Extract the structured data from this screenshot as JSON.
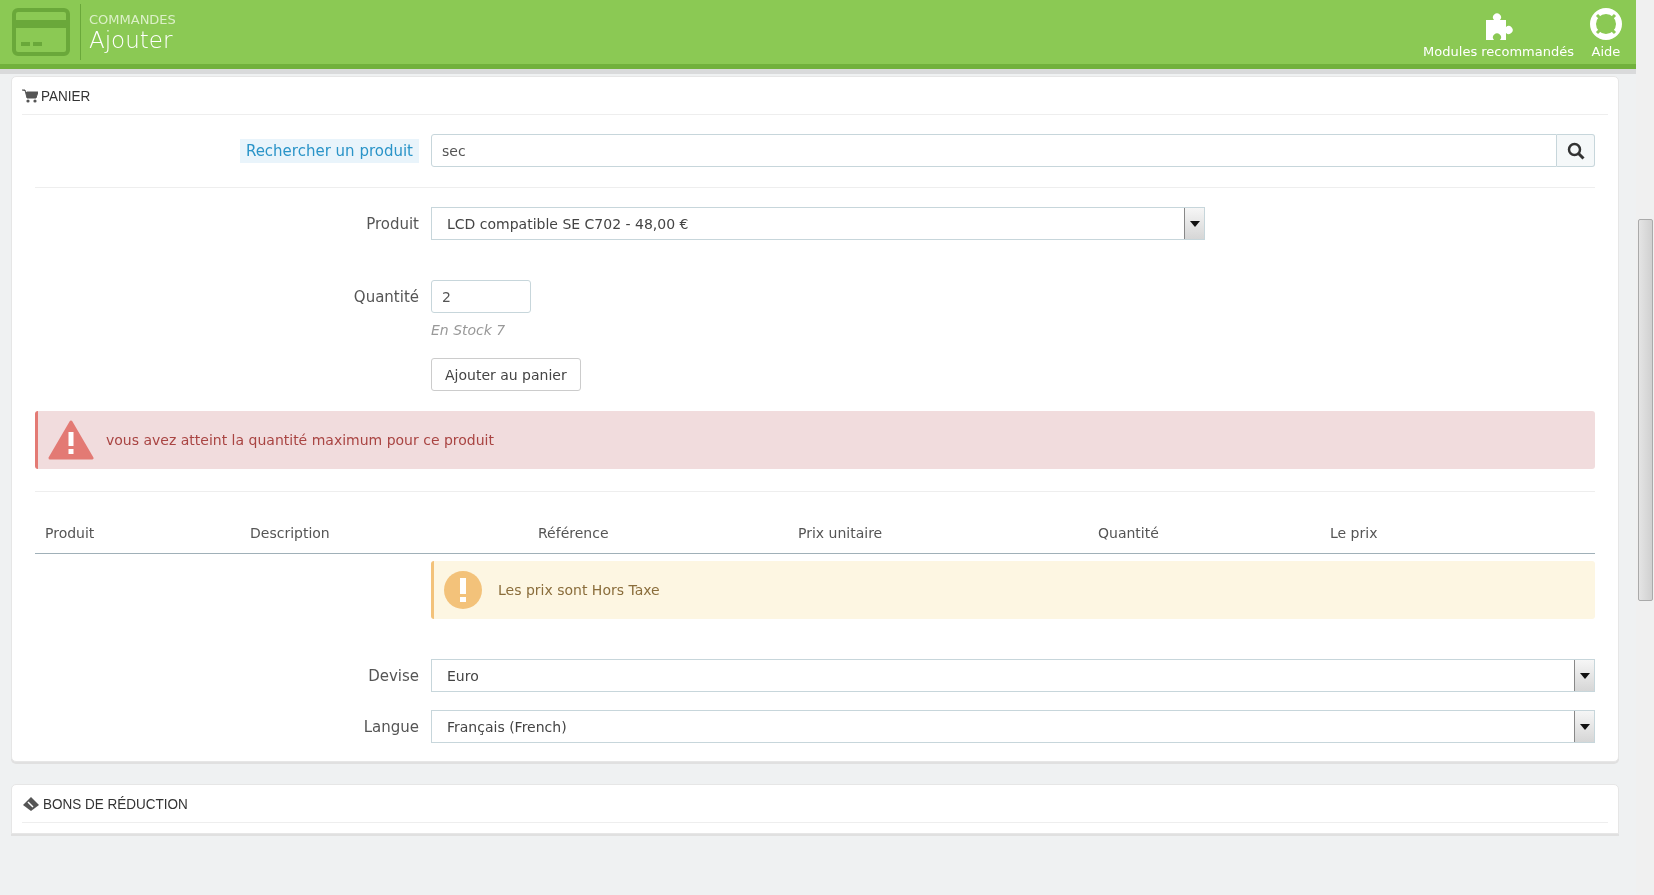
{
  "header": {
    "breadcrumb": "COMMANDES",
    "title": "Ajouter",
    "toolbar": [
      {
        "kind": "puzzle",
        "label": "Modules recommandés"
      },
      {
        "kind": "lifebuoy",
        "label": "Aide"
      }
    ]
  },
  "cart_panel": {
    "title": "PANIER",
    "search": {
      "label": "Rechercher un produit",
      "value": "sec"
    },
    "product": {
      "label": "Produit",
      "value": "LCD compatible SE C702 - 48,00 €"
    },
    "quantity": {
      "label": "Quantité",
      "value": "2",
      "stock_note": "En Stock 7"
    },
    "add_button": "Ajouter au panier",
    "error_alert": "vous avez atteint la quantité maximum pour ce produit",
    "table": {
      "columns": [
        "Produit",
        "Description",
        "Référence",
        "Prix unitaire",
        "Quantité",
        "Le prix"
      ]
    },
    "warning_alert": "Les prix sont Hors Taxe",
    "currency": {
      "label": "Devise",
      "value": "Euro"
    },
    "language": {
      "label": "Langue",
      "value": "Français (French)"
    }
  },
  "vouchers_panel": {
    "title": "BONS DE RÉDUCTION"
  }
}
